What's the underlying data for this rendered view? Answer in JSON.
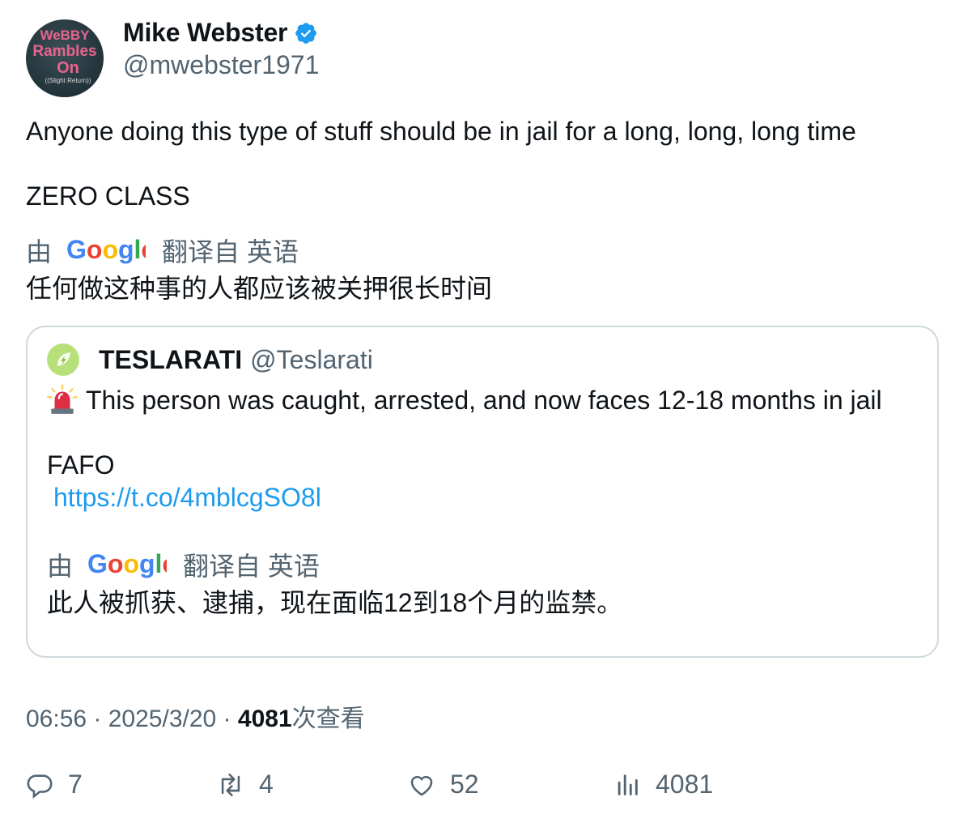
{
  "author": {
    "name": "Mike Webster",
    "handle": "@mwebster1971",
    "avatar_text": [
      "WeBBY",
      "Rambles",
      "On",
      "((Slight Return))"
    ],
    "verified_color": "#1d9bf0"
  },
  "tweet": {
    "line1": "Anyone doing this type of stuff should be in jail for a long, long, long time",
    "line2": "ZERO CLASS",
    "translation_by": "由",
    "translation_from": "翻译自 英语",
    "translation_text": "任何做这种事的人都应该被关押很长时间"
  },
  "quote": {
    "name": "TESLARATI",
    "handle": "@Teslarati",
    "line1": "This person was caught, arrested, and now faces 12-18 months in jail",
    "line2": "FAFO",
    "link": "https://t.co/4mblcgSO8l",
    "translation_by": "由",
    "translation_from": "翻译自 英语",
    "translation_text": "此人被抓获、逮捕，现在面临12到18个月的监禁。",
    "icon": "siren-icon"
  },
  "meta": {
    "time": "06:56",
    "sep": " · ",
    "date": "2025/3/20",
    "views_count": "4081",
    "views_label": "次查看"
  },
  "actions": {
    "replies": "7",
    "reposts": "4",
    "likes": "52",
    "views": "4081"
  },
  "colors": {
    "text": "#0f1419",
    "muted": "#536471",
    "link": "#1d9bf0",
    "border": "#cfd9de"
  }
}
